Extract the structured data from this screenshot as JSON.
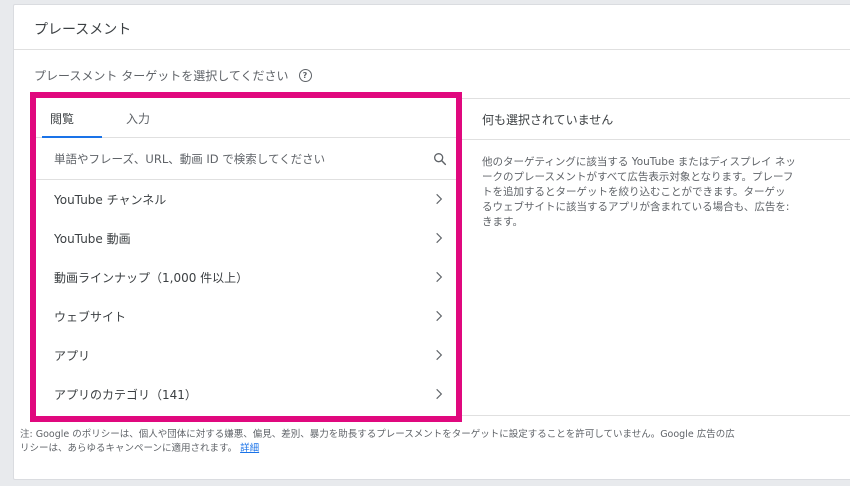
{
  "card": {
    "title": "プレースメント",
    "section_label": "プレースメント ターゲットを選択してください",
    "help_icon_glyph": "?"
  },
  "browse": {
    "tabs": [
      {
        "label": "閲覧",
        "active": true
      },
      {
        "label": "入力",
        "active": false
      }
    ],
    "search": {
      "placeholder": "単語やフレーズ、URL、動画 ID で検索してください",
      "value": ""
    },
    "items": [
      {
        "label": "YouTube チャンネル"
      },
      {
        "label": "YouTube 動画"
      },
      {
        "label": "動画ラインナップ（1,000 件以上）"
      },
      {
        "label": "ウェブサイト"
      },
      {
        "label": "アプリ"
      },
      {
        "label": "アプリのカテゴリ（141）"
      }
    ]
  },
  "selected": {
    "header": "何も選択されていません",
    "description": "他のターゲティングに該当する YouTube またはディスプレイ ネッ\nークのプレースメントがすべて広告表示対象となります。プレーフ\nトを追加するとターゲットを絞り込むことができます。ターゲッ\nるウェブサイトに該当するアプリが含まれている場合も、広告を:\nきます。"
  },
  "footnote": {
    "text": "注: Google のポリシーは、個人や団体に対する嫌悪、偏見、差別、暴力を助長するプレースメントをターゲットに設定することを許可していません。Google 広告の広\nリシーは、あらゆるキャンペーンに適用されます。",
    "link": "詳細"
  },
  "colors": {
    "highlight_border": "#e0087e",
    "tab_underline": "#1a73e8",
    "link": "#1a73e8"
  }
}
